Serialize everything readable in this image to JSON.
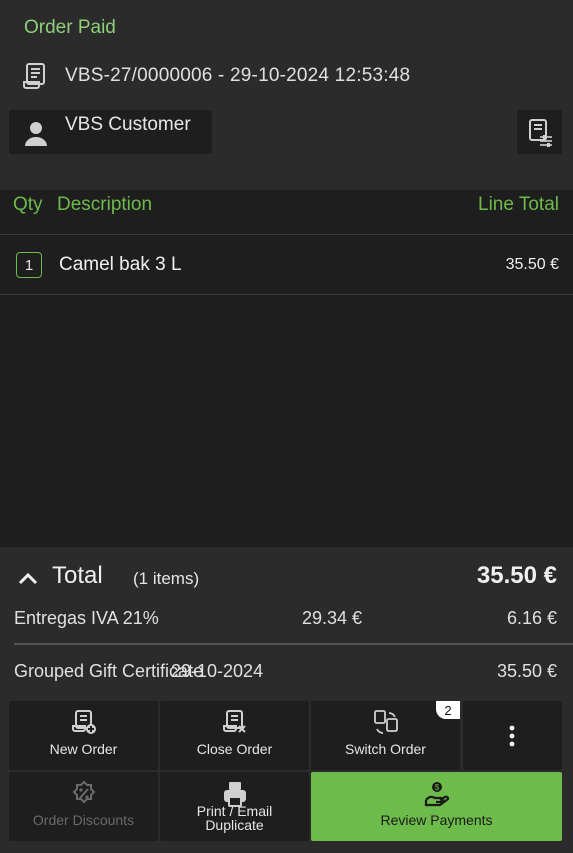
{
  "header": {
    "status": "Order Paid",
    "order_ref": "VBS-27/0000006 - 29-10-2024 12:53:48",
    "customer_name": "VBS Customer"
  },
  "columns": {
    "qty": "Qty",
    "description": "Description",
    "line_total": "Line Total"
  },
  "lines": [
    {
      "qty": "1",
      "description": "Camel bak 3 L",
      "total": "35.50 €"
    }
  ],
  "totals": {
    "label": "Total",
    "item_count": "(1 items)",
    "amount": "35.50 €",
    "tax": {
      "name": "Entregas IVA 21%",
      "base": "29.34 €",
      "value": "6.16 €"
    },
    "gift": {
      "name": "Grouped Gift Certificate",
      "date": "29-10-2024",
      "value": "35.50 €"
    }
  },
  "actions": {
    "new_order": "New Order",
    "close_order": "Close Order",
    "switch_order": "Switch Order",
    "switch_badge": "2",
    "order_discounts": "Order Discounts",
    "print_line1": "Print / Email",
    "print_line2": "Duplicate",
    "review_payments": "Review Payments"
  },
  "colors": {
    "accent": "#6dbb4a",
    "status": "#8fcf7a",
    "background": "#1e1e1e",
    "panel": "#2b2b2b"
  },
  "icons": {
    "order": "receipt-icon",
    "customer": "person-icon",
    "invoice": "invoice-settings-icon",
    "total_toggle": "chevron-up-icon",
    "new_order": "receipt-add-icon",
    "close_order": "receipt-close-icon",
    "switch_order": "receipt-switch-icon",
    "more": "more-vertical-icon",
    "discounts": "discount-badge-icon",
    "print": "printer-icon",
    "payments": "hand-coin-icon"
  }
}
